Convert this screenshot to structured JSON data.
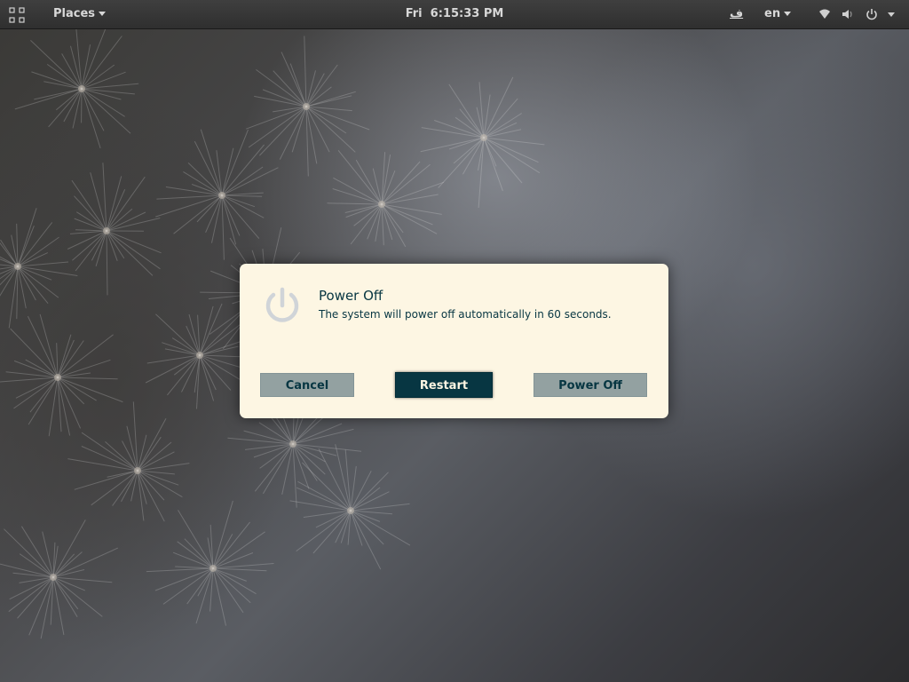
{
  "topbar": {
    "activities_icon": "grid-icon",
    "places_label": "Places",
    "clock_day": "Fri",
    "clock_time": "6:15:33 PM",
    "keyboard_indicator": "ﻑ",
    "language_label": "en",
    "status_icons": [
      "wifi-icon",
      "volume-icon",
      "power-icon",
      "chevron-down-icon"
    ]
  },
  "dialog": {
    "icon": "power-icon",
    "title": "Power Off",
    "message": "The system will power off automatically in 60 seconds.",
    "buttons": {
      "cancel": "Cancel",
      "restart": "Restart",
      "power_off": "Power Off"
    }
  },
  "colors": {
    "dialog_bg": "#fdf6e3",
    "text": "#073642",
    "button_bg": "#93a1a1",
    "focused_button_bg": "#073642",
    "topbar_bg": "#333333"
  }
}
